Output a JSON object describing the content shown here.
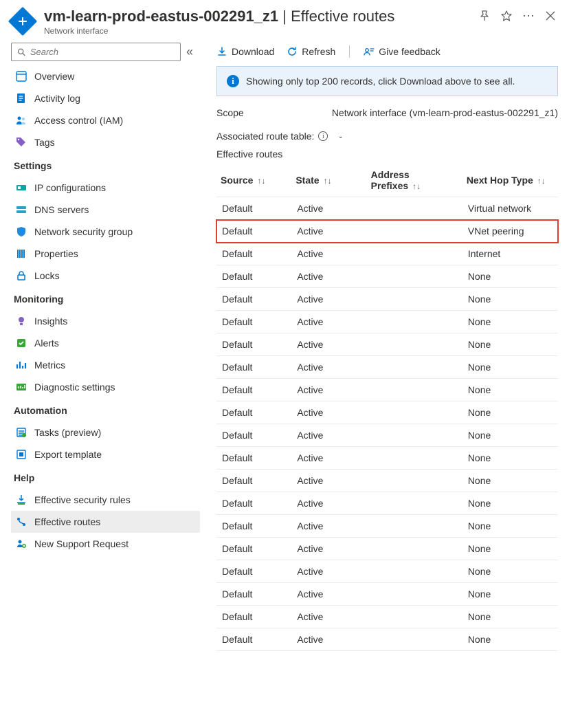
{
  "header": {
    "title_resource": "vm-learn-prod-eastus-002291_z1",
    "title_separator": " | ",
    "title_page": "Effective routes",
    "subtitle": "Network interface"
  },
  "search": {
    "placeholder": "Search"
  },
  "sidebar": {
    "top": [
      {
        "key": "overview",
        "label": "Overview",
        "iconColor": "#0078d4"
      },
      {
        "key": "activity-log",
        "label": "Activity log",
        "iconColor": "#0078d4"
      },
      {
        "key": "access-control",
        "label": "Access control (IAM)",
        "iconColor": "#0078d4"
      },
      {
        "key": "tags",
        "label": "Tags",
        "iconColor": "#8460c6"
      }
    ],
    "groups": [
      {
        "label": "Settings",
        "items": [
          {
            "key": "ip-configurations",
            "label": "IP configurations",
            "iconColor": "#0ea5a4"
          },
          {
            "key": "dns-servers",
            "label": "DNS servers",
            "iconColor": "#2aa0c9"
          },
          {
            "key": "nsg",
            "label": "Network security group",
            "iconColor": "#1f8ae0"
          },
          {
            "key": "properties",
            "label": "Properties",
            "iconColor": "#0078d4"
          },
          {
            "key": "locks",
            "label": "Locks",
            "iconColor": "#0078d4"
          }
        ]
      },
      {
        "label": "Monitoring",
        "items": [
          {
            "key": "insights",
            "label": "Insights",
            "iconColor": "#8460c6"
          },
          {
            "key": "alerts",
            "label": "Alerts",
            "iconColor": "#3aa537"
          },
          {
            "key": "metrics",
            "label": "Metrics",
            "iconColor": "#0078d4"
          },
          {
            "key": "diagnostic-settings",
            "label": "Diagnostic settings",
            "iconColor": "#3aa537"
          }
        ]
      },
      {
        "label": "Automation",
        "items": [
          {
            "key": "tasks",
            "label": "Tasks (preview)",
            "iconColor": "#0078d4"
          },
          {
            "key": "export-template",
            "label": "Export template",
            "iconColor": "#0078d4"
          }
        ]
      },
      {
        "label": "Help",
        "items": [
          {
            "key": "effective-security-rules",
            "label": "Effective security rules",
            "iconColor": "#0078d4"
          },
          {
            "key": "effective-routes",
            "label": "Effective routes",
            "iconColor": "#0078d4",
            "selected": true
          },
          {
            "key": "new-support-request",
            "label": "New Support Request",
            "iconColor": "#0078d4"
          }
        ]
      }
    ]
  },
  "toolbar": {
    "download": "Download",
    "refresh": "Refresh",
    "feedback": "Give feedback"
  },
  "infobar": {
    "text": "Showing only top 200 records, click Download above to see all."
  },
  "scope": {
    "label": "Scope",
    "value": "Network interface (vm-learn-prod-eastus-002291_z1)"
  },
  "associated": {
    "label": "Associated route table:",
    "value": "-"
  },
  "table": {
    "title": "Effective routes",
    "columns": [
      "Source",
      "State",
      "Address Prefixes",
      "Next Hop Type"
    ],
    "rows": [
      {
        "source": "Default",
        "state": "Active",
        "prefixes": "",
        "nextHop": "Virtual network",
        "highlight": false
      },
      {
        "source": "Default",
        "state": "Active",
        "prefixes": "",
        "nextHop": "VNet peering",
        "highlight": true
      },
      {
        "source": "Default",
        "state": "Active",
        "prefixes": "",
        "nextHop": "Internet",
        "highlight": false
      },
      {
        "source": "Default",
        "state": "Active",
        "prefixes": "",
        "nextHop": "None",
        "highlight": false
      },
      {
        "source": "Default",
        "state": "Active",
        "prefixes": "",
        "nextHop": "None",
        "highlight": false
      },
      {
        "source": "Default",
        "state": "Active",
        "prefixes": "",
        "nextHop": "None",
        "highlight": false
      },
      {
        "source": "Default",
        "state": "Active",
        "prefixes": "",
        "nextHop": "None",
        "highlight": false
      },
      {
        "source": "Default",
        "state": "Active",
        "prefixes": "",
        "nextHop": "None",
        "highlight": false
      },
      {
        "source": "Default",
        "state": "Active",
        "prefixes": "",
        "nextHop": "None",
        "highlight": false
      },
      {
        "source": "Default",
        "state": "Active",
        "prefixes": "",
        "nextHop": "None",
        "highlight": false
      },
      {
        "source": "Default",
        "state": "Active",
        "prefixes": "",
        "nextHop": "None",
        "highlight": false
      },
      {
        "source": "Default",
        "state": "Active",
        "prefixes": "",
        "nextHop": "None",
        "highlight": false
      },
      {
        "source": "Default",
        "state": "Active",
        "prefixes": "",
        "nextHop": "None",
        "highlight": false
      },
      {
        "source": "Default",
        "state": "Active",
        "prefixes": "",
        "nextHop": "None",
        "highlight": false
      },
      {
        "source": "Default",
        "state": "Active",
        "prefixes": "",
        "nextHop": "None",
        "highlight": false
      },
      {
        "source": "Default",
        "state": "Active",
        "prefixes": "",
        "nextHop": "None",
        "highlight": false
      },
      {
        "source": "Default",
        "state": "Active",
        "prefixes": "",
        "nextHop": "None",
        "highlight": false
      },
      {
        "source": "Default",
        "state": "Active",
        "prefixes": "",
        "nextHop": "None",
        "highlight": false
      },
      {
        "source": "Default",
        "state": "Active",
        "prefixes": "",
        "nextHop": "None",
        "highlight": false
      },
      {
        "source": "Default",
        "state": "Active",
        "prefixes": "",
        "nextHop": "None",
        "highlight": false
      }
    ]
  }
}
